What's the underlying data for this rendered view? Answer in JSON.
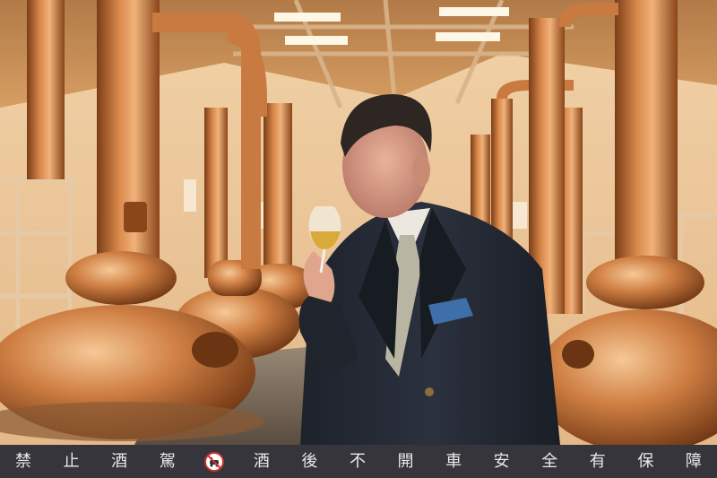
{
  "photo": {
    "subject": "man-nosing-whisky-glass",
    "setting": "copper-pot-still-house",
    "colors": {
      "copper": "#c9773c",
      "copper_dark": "#7a3d16",
      "ceiling_wood": "#c08a55",
      "wall": "#e9c9a3",
      "suit": "#232832",
      "pocket_square": "#3f6fa8",
      "whisky": "#d9a93a"
    }
  },
  "banner": {
    "chars": [
      "禁",
      "止",
      "酒",
      "駕",
      "酒",
      "後",
      "不",
      "開",
      "車",
      "安",
      "全",
      "有",
      "保",
      "障"
    ],
    "icon": "no-drink-driving-icon",
    "colors": {
      "background": "#35353b",
      "text": "#e9e9ea",
      "icon_red": "#d0312d"
    }
  }
}
